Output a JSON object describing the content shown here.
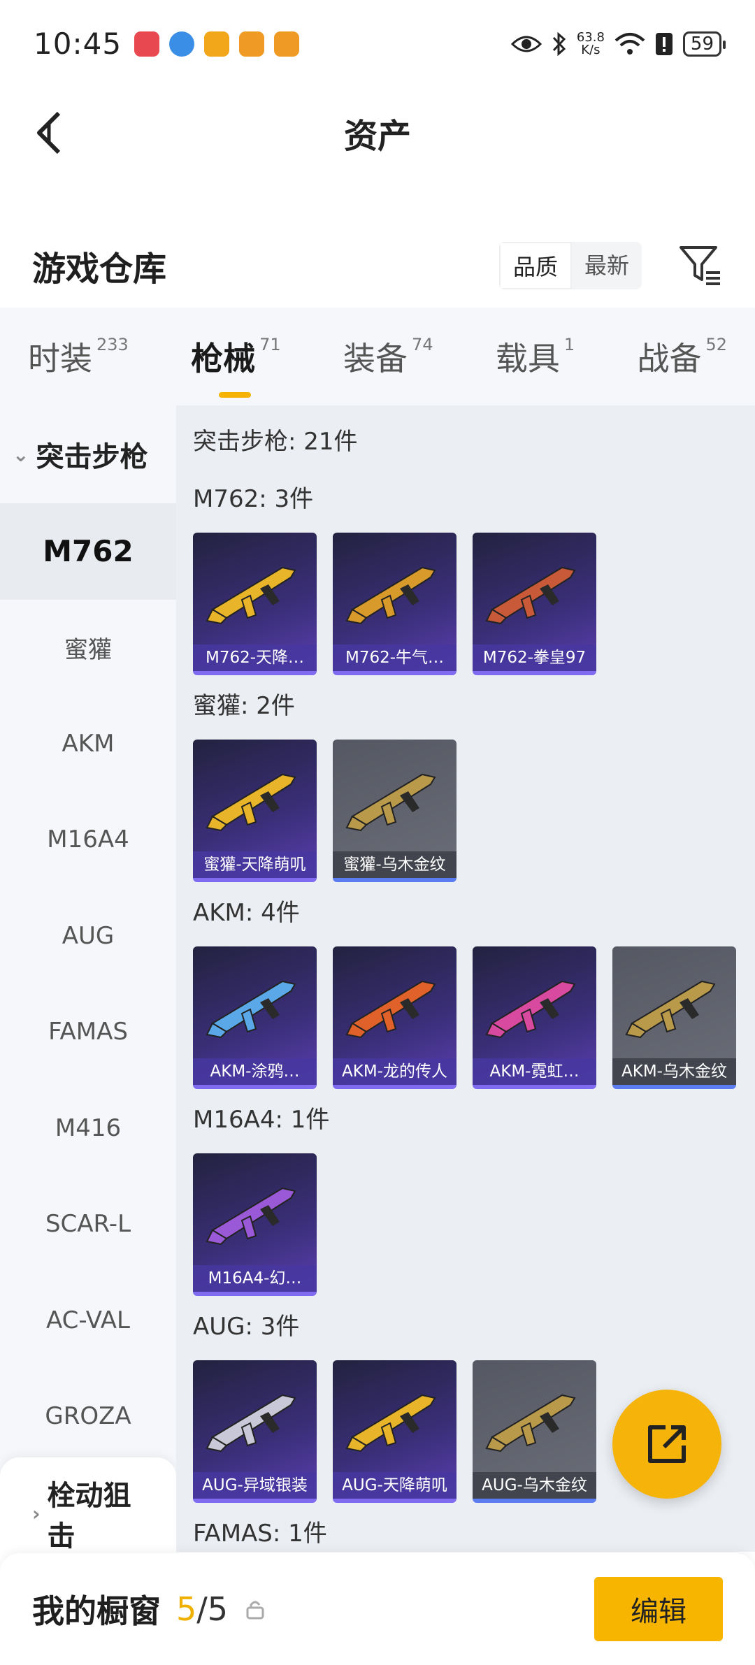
{
  "statusbar": {
    "time": "10:45",
    "speed_top": "63.8",
    "speed_bottom": "K/s",
    "battery": "59",
    "notif_colors": [
      "#e8484f",
      "#3b8ee6",
      "#f2a71b",
      "#f09a26",
      "#f09a26"
    ]
  },
  "header": {
    "title": "资产",
    "back_icon": "back-arrow-icon"
  },
  "warehouse": {
    "title": "游戏仓库",
    "sort_options": [
      "品质",
      "最新"
    ],
    "filter_icon": "filter-icon"
  },
  "category_tabs": [
    {
      "label": "时装",
      "count": "233"
    },
    {
      "label": "枪械",
      "count": "71"
    },
    {
      "label": "装备",
      "count": "74"
    },
    {
      "label": "载具",
      "count": "1"
    },
    {
      "label": "战备",
      "count": "52"
    }
  ],
  "sidebar": {
    "group": "突击步枪",
    "items": [
      "M762",
      "蜜獾",
      "AKM",
      "M16A4",
      "AUG",
      "FAMAS",
      "M416",
      "SCAR-L",
      "AC-VAL",
      "GROZA"
    ],
    "next_group": "栓动狙击"
  },
  "content": {
    "summary": "突击步枪: 21件",
    "sections": [
      {
        "title": "M762: 3件",
        "cards": [
          {
            "name": "M762-天降…",
            "style": "purple",
            "color": "#e8b52a"
          },
          {
            "name": "M762-牛气…",
            "style": "purple",
            "color": "#d89a2a"
          },
          {
            "name": "M762-拳皇97",
            "style": "purple",
            "color": "#c85a3a"
          }
        ]
      },
      {
        "title": "蜜獾: 2件",
        "cards": [
          {
            "name": "蜜獾-天降萌叽",
            "style": "purple",
            "color": "#e8b52a"
          },
          {
            "name": "蜜獾-乌木金纹",
            "style": "gray",
            "color": "#b89a4a"
          }
        ]
      },
      {
        "title": "AKM: 4件",
        "cards": [
          {
            "name": "AKM-涂鸦…",
            "style": "purple",
            "color": "#5aa8e8"
          },
          {
            "name": "AKM-龙的传人",
            "style": "purple",
            "color": "#e0622a"
          },
          {
            "name": "AKM-霓虹…",
            "style": "purple",
            "color": "#d84aa0"
          },
          {
            "name": "AKM-乌木金纹",
            "style": "gray",
            "color": "#b89a4a"
          }
        ]
      },
      {
        "title": "M16A4: 1件",
        "cards": [
          {
            "name": "M16A4-幻…",
            "style": "purple",
            "color": "#9a5ad8"
          }
        ]
      },
      {
        "title": "AUG: 3件",
        "cards": [
          {
            "name": "AUG-异域银装",
            "style": "purple",
            "color": "#c8c8d8"
          },
          {
            "name": "AUG-天降萌叽",
            "style": "purple",
            "color": "#e8b52a"
          },
          {
            "name": "AUG-乌木金纹",
            "style": "gray",
            "color": "#b89a4a"
          }
        ]
      },
      {
        "title": "FAMAS: 1件",
        "cards": []
      }
    ]
  },
  "fab_icon": "share-out-icon",
  "showcase": {
    "label": "我的橱窗",
    "current": "5",
    "separator": "/",
    "total": "5",
    "lock_icon": "lock-icon",
    "edit_label": "编辑"
  },
  "colors": {
    "accent": "#f5b300",
    "card_purple": "#3b2f7a",
    "card_gray": "#5f626c"
  }
}
